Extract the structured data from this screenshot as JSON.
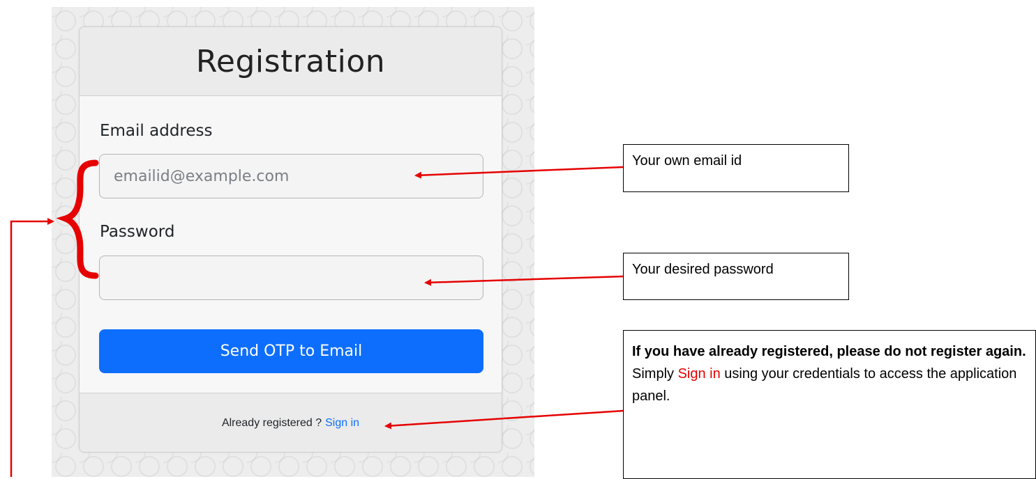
{
  "form": {
    "title": "Registration",
    "email_label": "Email address",
    "email_placeholder": "emailid@example.com",
    "password_label": "Password",
    "password_value": "",
    "submit_label": "Send OTP to Email",
    "footer_text": "Already registered ?",
    "footer_link": "Sign in"
  },
  "annotations": {
    "email_note": "Your own email id",
    "password_note": "Your desired password",
    "registered_note": {
      "bold_line": "If you have already registered, please do not register again.",
      "text_before": "Simply",
      "link_text": "Sign in",
      "text_after": "using your credentials to access the application panel."
    }
  },
  "colors": {
    "primary_button": "#0d6efd",
    "link": "#0d6efd",
    "annotation_arrow": "#e60000"
  }
}
